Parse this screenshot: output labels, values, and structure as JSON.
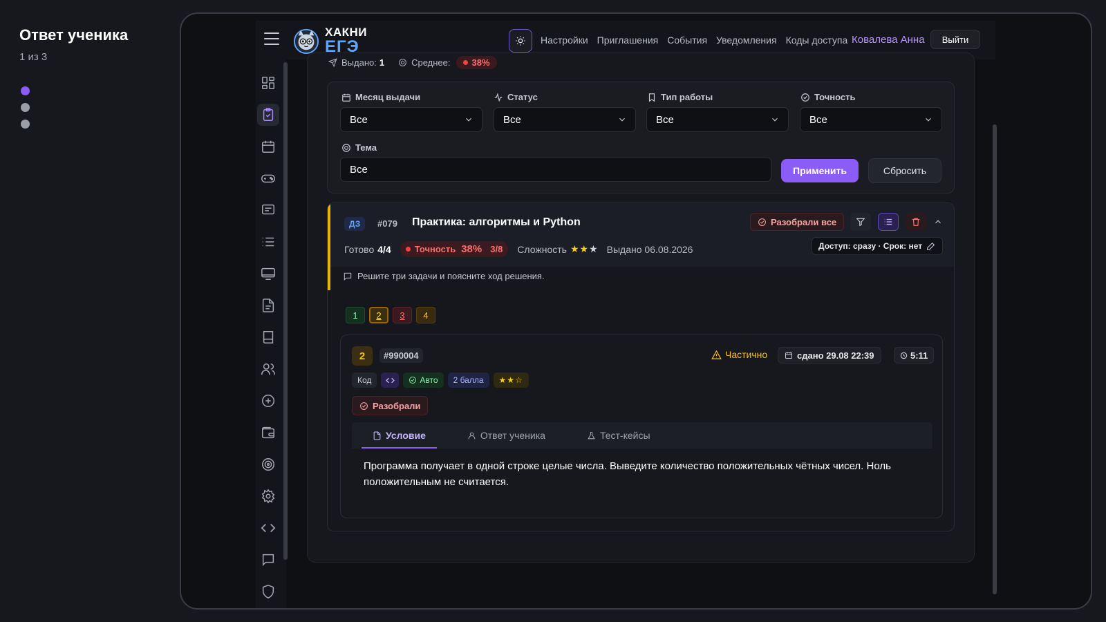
{
  "caption": {
    "title": "Ответ ученика",
    "subtitle": "1 из 3"
  },
  "header": {
    "logo_line1": "ХАКНИ",
    "logo_line2": "ЕГЭ",
    "nav": [
      "Настройки",
      "Приглашения",
      "События",
      "Уведомления",
      "Коды доступа"
    ],
    "user": "Ковалева Анна",
    "logout": "Выйти"
  },
  "stats": {
    "issued_label": "Выдано:",
    "issued_value": "1",
    "avg_label": "Среднее:",
    "avg_value": "38%"
  },
  "filters": {
    "month": {
      "label": "Месяц выдачи",
      "value": "Все"
    },
    "status": {
      "label": "Статус",
      "value": "Все"
    },
    "type": {
      "label": "Тип работы",
      "value": "Все"
    },
    "accuracy": {
      "label": "Точность",
      "value": "Все"
    },
    "topic": {
      "label": "Тема",
      "value": "Все"
    },
    "apply": "Применить",
    "reset": "Сбросить"
  },
  "assignment": {
    "tag": "ДЗ",
    "number": "#079",
    "title": "Практика: алгоритмы и Python",
    "done_label": "Готово",
    "done_value": "4/4",
    "accuracy_label": "Точность",
    "accuracy_value": "38%",
    "accuracy_fraction": "3/8",
    "difficulty_label": "Сложность",
    "issued": "Выдано 06.08.2026",
    "reviewed_all": "Разобрали все",
    "access": "Доступ: сразу · Срок: нет",
    "comment": "Решите три задачи и поясните ход решения.",
    "task_numbers": [
      "1",
      "2",
      "3",
      "4"
    ]
  },
  "task": {
    "index": "2",
    "id": "#990004",
    "status": "Частично",
    "submitted": "сдано 29.08 22:39",
    "time": "5:11",
    "tag_code": "Код",
    "tag_auto": "Авто",
    "tag_points": "2 балла",
    "reviewed": "Разобрали",
    "tabs": [
      "Условие",
      "Ответ ученика",
      "Тест-кейсы"
    ],
    "text": "Программа получает в одной строке целые числа. Выведите количество положительных чётных чисел. Ноль положительным не считается."
  }
}
